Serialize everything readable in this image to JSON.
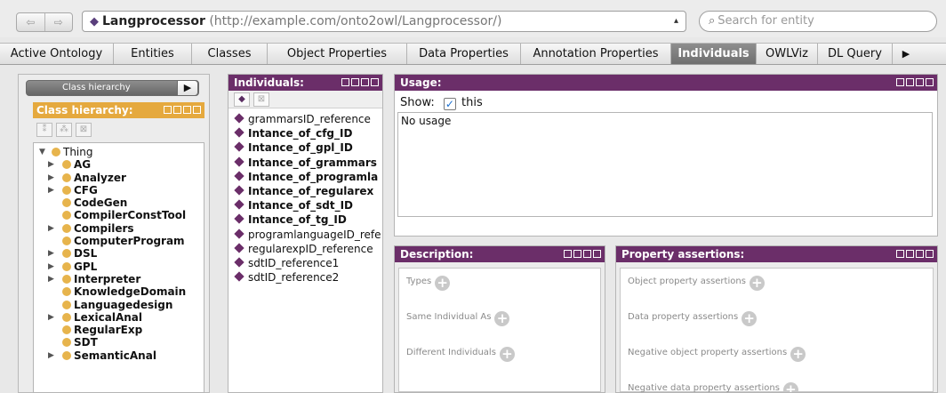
{
  "address_bar": {
    "entity_name": "Langprocessor",
    "entity_iri": "(http://example.com/onto2owl/Langprocessor/)",
    "search_placeholder": "Search for entity"
  },
  "tabs": [
    {
      "label": "Active Ontology",
      "active": false
    },
    {
      "label": "Entities",
      "active": false
    },
    {
      "label": "Classes",
      "active": false
    },
    {
      "label": "Object Properties",
      "active": false
    },
    {
      "label": "Data Properties",
      "active": false
    },
    {
      "label": "Annotation Properties",
      "active": false
    },
    {
      "label": "Individuals",
      "active": true
    },
    {
      "label": "OWLViz",
      "active": false
    },
    {
      "label": "DL Query",
      "active": false
    }
  ],
  "class_hierarchy": {
    "toggle_label": "Class hierarchy",
    "header": "Class hierarchy:",
    "tree": [
      {
        "label": "Thing",
        "depth": 0,
        "expander": "open",
        "bold": false
      },
      {
        "label": "AG",
        "depth": 1,
        "expander": "closed",
        "bold": true
      },
      {
        "label": "Analyzer",
        "depth": 1,
        "expander": "closed",
        "bold": true
      },
      {
        "label": "CFG",
        "depth": 1,
        "expander": "closed",
        "bold": true
      },
      {
        "label": "CodeGen",
        "depth": 1,
        "expander": "none",
        "bold": true
      },
      {
        "label": "CompilerConstTool",
        "depth": 1,
        "expander": "none",
        "bold": true
      },
      {
        "label": "Compilers",
        "depth": 1,
        "expander": "closed",
        "bold": true
      },
      {
        "label": "ComputerProgram",
        "depth": 1,
        "expander": "none",
        "bold": true
      },
      {
        "label": "DSL",
        "depth": 1,
        "expander": "closed",
        "bold": true
      },
      {
        "label": "GPL",
        "depth": 1,
        "expander": "closed",
        "bold": true
      },
      {
        "label": "Interpreter",
        "depth": 1,
        "expander": "closed",
        "bold": true
      },
      {
        "label": "KnowledgeDomain",
        "depth": 1,
        "expander": "none",
        "bold": true
      },
      {
        "label": "Languagedesign",
        "depth": 1,
        "expander": "none",
        "bold": true
      },
      {
        "label": "LexicalAnal",
        "depth": 1,
        "expander": "closed",
        "bold": true
      },
      {
        "label": "RegularExp",
        "depth": 1,
        "expander": "none",
        "bold": true
      },
      {
        "label": "SDT",
        "depth": 1,
        "expander": "none",
        "bold": true
      },
      {
        "label": "SemanticAnal",
        "depth": 1,
        "expander": "closed",
        "bold": true
      }
    ]
  },
  "individuals": {
    "header": "Individuals:",
    "items": [
      {
        "label": "grammarsID_reference",
        "bold": false
      },
      {
        "label": "Intance_of_cfg_ID",
        "bold": true
      },
      {
        "label": "Intance_of_gpl_ID",
        "bold": true
      },
      {
        "label": "Intance_of_grammars",
        "bold": true
      },
      {
        "label": "Intance_of_programla",
        "bold": true
      },
      {
        "label": "Intance_of_regularex",
        "bold": true
      },
      {
        "label": "Intance_of_sdt_ID",
        "bold": true
      },
      {
        "label": "Intance_of_tg_ID",
        "bold": true
      },
      {
        "label": "programlanguageID_refe",
        "bold": false
      },
      {
        "label": "regularexpID_reference",
        "bold": false
      },
      {
        "label": "sdtID_reference1",
        "bold": false
      },
      {
        "label": "sdtID_reference2",
        "bold": false
      }
    ]
  },
  "usage": {
    "header": "Usage:",
    "show_label": "Show:",
    "this_label": "this",
    "this_checked": true,
    "empty_text": "No usage"
  },
  "description": {
    "header": "Description:",
    "sections": [
      "Types",
      "Same Individual As",
      "Different Individuals"
    ]
  },
  "property_assertions": {
    "header": "Property assertions:",
    "sections": [
      "Object property assertions",
      "Data property assertions",
      "Negative object property assertions",
      "Negative data property assertions"
    ]
  },
  "colors": {
    "panel_header": "#6b2e69",
    "class_header": "#e5a93e",
    "class_dot": "#e7b44c",
    "active_tab": "#7d7d7d"
  }
}
